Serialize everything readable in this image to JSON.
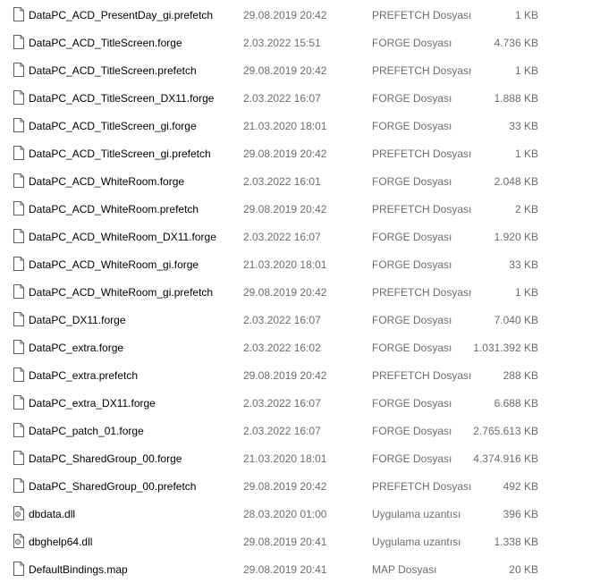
{
  "files": [
    {
      "name": "DataPC_ACD_PresentDay_gi.prefetch",
      "date": "29.08.2019 20:42",
      "type": "PREFETCH Dosyası",
      "size": "1 KB",
      "icon": "file-icon"
    },
    {
      "name": "DataPC_ACD_TitleScreen.forge",
      "date": "2.03.2022 15:51",
      "type": "FORGE Dosyası",
      "size": "4.736 KB",
      "icon": "file-icon"
    },
    {
      "name": "DataPC_ACD_TitleScreen.prefetch",
      "date": "29.08.2019 20:42",
      "type": "PREFETCH Dosyası",
      "size": "1 KB",
      "icon": "file-icon"
    },
    {
      "name": "DataPC_ACD_TitleScreen_DX11.forge",
      "date": "2.03.2022 16:07",
      "type": "FORGE Dosyası",
      "size": "1.888 KB",
      "icon": "file-icon"
    },
    {
      "name": "DataPC_ACD_TitleScreen_gi.forge",
      "date": "21.03.2020 18:01",
      "type": "FORGE Dosyası",
      "size": "33 KB",
      "icon": "file-icon"
    },
    {
      "name": "DataPC_ACD_TitleScreen_gi.prefetch",
      "date": "29.08.2019 20:42",
      "type": "PREFETCH Dosyası",
      "size": "1 KB",
      "icon": "file-icon"
    },
    {
      "name": "DataPC_ACD_WhiteRoom.forge",
      "date": "2.03.2022 16:01",
      "type": "FORGE Dosyası",
      "size": "2.048 KB",
      "icon": "file-icon"
    },
    {
      "name": "DataPC_ACD_WhiteRoom.prefetch",
      "date": "29.08.2019 20:42",
      "type": "PREFETCH Dosyası",
      "size": "2 KB",
      "icon": "file-icon"
    },
    {
      "name": "DataPC_ACD_WhiteRoom_DX11.forge",
      "date": "2.03.2022 16:07",
      "type": "FORGE Dosyası",
      "size": "1.920 KB",
      "icon": "file-icon"
    },
    {
      "name": "DataPC_ACD_WhiteRoom_gi.forge",
      "date": "21.03.2020 18:01",
      "type": "FORGE Dosyası",
      "size": "33 KB",
      "icon": "file-icon"
    },
    {
      "name": "DataPC_ACD_WhiteRoom_gi.prefetch",
      "date": "29.08.2019 20:42",
      "type": "PREFETCH Dosyası",
      "size": "1 KB",
      "icon": "file-icon"
    },
    {
      "name": "DataPC_DX11.forge",
      "date": "2.03.2022 16:07",
      "type": "FORGE Dosyası",
      "size": "7.040 KB",
      "icon": "file-icon"
    },
    {
      "name": "DataPC_extra.forge",
      "date": "2.03.2022 16:02",
      "type": "FORGE Dosyası",
      "size": "1.031.392 KB",
      "icon": "file-icon"
    },
    {
      "name": "DataPC_extra.prefetch",
      "date": "29.08.2019 20:42",
      "type": "PREFETCH Dosyası",
      "size": "288 KB",
      "icon": "file-icon"
    },
    {
      "name": "DataPC_extra_DX11.forge",
      "date": "2.03.2022 16:07",
      "type": "FORGE Dosyası",
      "size": "6.688 KB",
      "icon": "file-icon"
    },
    {
      "name": "DataPC_patch_01.forge",
      "date": "2.03.2022 16:07",
      "type": "FORGE Dosyası",
      "size": "2.765.613 KB",
      "icon": "file-icon"
    },
    {
      "name": "DataPC_SharedGroup_00.forge",
      "date": "21.03.2020 18:01",
      "type": "FORGE Dosyası",
      "size": "4.374.916 KB",
      "icon": "file-icon"
    },
    {
      "name": "DataPC_SharedGroup_00.prefetch",
      "date": "29.08.2019 20:42",
      "type": "PREFETCH Dosyası",
      "size": "492 KB",
      "icon": "file-icon"
    },
    {
      "name": "dbdata.dll",
      "date": "28.03.2020 01:00",
      "type": "Uygulama uzantısı",
      "size": "396 KB",
      "icon": "dll-file-icon"
    },
    {
      "name": "dbghelp64.dll",
      "date": "29.08.2019 20:41",
      "type": "Uygulama uzantısı",
      "size": "1.338 KB",
      "icon": "dll-file-icon"
    },
    {
      "name": "DefaultBindings.map",
      "date": "29.08.2019 20:41",
      "type": "MAP Dosyası",
      "size": "20 KB",
      "icon": "file-icon"
    }
  ],
  "colors": {
    "name_text": "#000000",
    "meta_text": "#6d6d6d",
    "icon_outline": "#5f5f5f",
    "hover_bg": "#e5f3ff"
  }
}
